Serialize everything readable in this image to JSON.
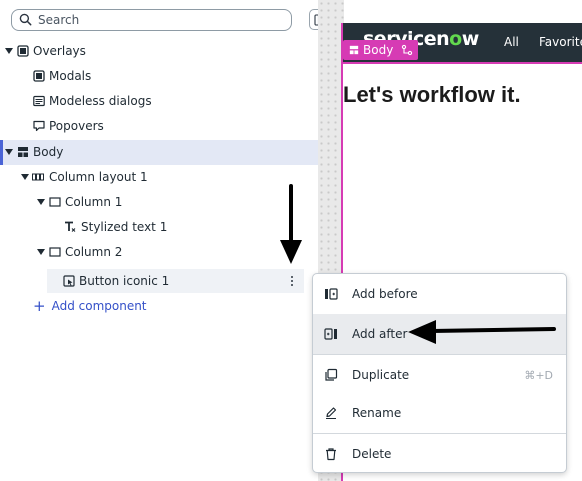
{
  "search": {
    "placeholder": "Search"
  },
  "tree": {
    "overlays": "Overlays",
    "modals": "Modals",
    "modeless": "Modeless dialogs",
    "popovers": "Popovers",
    "body": "Body",
    "column_layout": "Column layout 1",
    "column1": "Column 1",
    "stylized_text": "Stylized text 1",
    "column2": "Column 2",
    "button_iconic": "Button iconic 1",
    "add_component": "Add component"
  },
  "preview": {
    "logo_text_a": "servicen",
    "logo_o": "o",
    "logo_text_b": "w",
    "nav_all": "All",
    "nav_favorites": "Favorite",
    "body_tag": "Body",
    "headline": "Let's workflow it."
  },
  "menu": {
    "add_before": "Add before",
    "add_after": "Add after",
    "duplicate": "Duplicate",
    "duplicate_shortcut": "⌘+D",
    "rename": "Rename",
    "delete": "Delete"
  },
  "colors": {
    "accent": "#4a64d6",
    "selection_pink": "#d63bb4",
    "nav_bg": "#253139",
    "logo_green": "#62d84e",
    "link_blue": "#3450c8"
  }
}
